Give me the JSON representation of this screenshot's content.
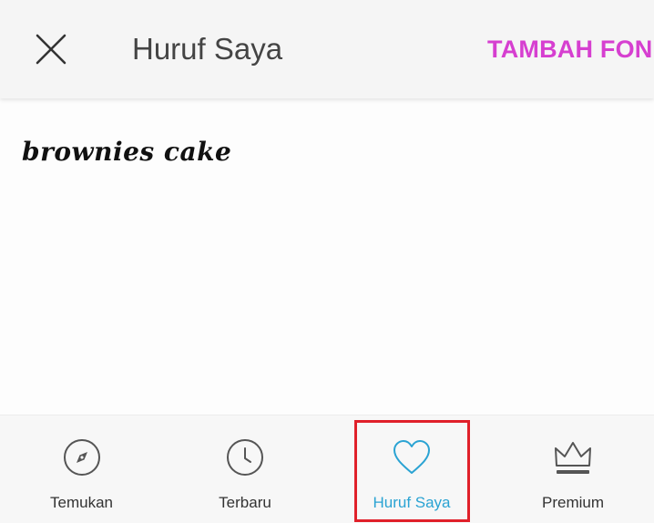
{
  "header": {
    "title": "Huruf Saya",
    "add_font_label": "TAMBAH FON",
    "close_icon": "close-icon"
  },
  "fonts": [
    {
      "preview_text": "brownies cake"
    }
  ],
  "nav": {
    "items": [
      {
        "label": "Temukan",
        "icon": "compass-icon",
        "active": false
      },
      {
        "label": "Terbaru",
        "icon": "clock-icon",
        "active": false
      },
      {
        "label": "Huruf Saya",
        "icon": "heart-icon",
        "active": true
      },
      {
        "label": "Premium",
        "icon": "crown-icon",
        "active": false
      }
    ]
  },
  "colors": {
    "accent_pink": "#d63fd0",
    "active_blue": "#2aa3d3",
    "highlight_red": "#e0202a",
    "icon_gray": "#555555"
  }
}
